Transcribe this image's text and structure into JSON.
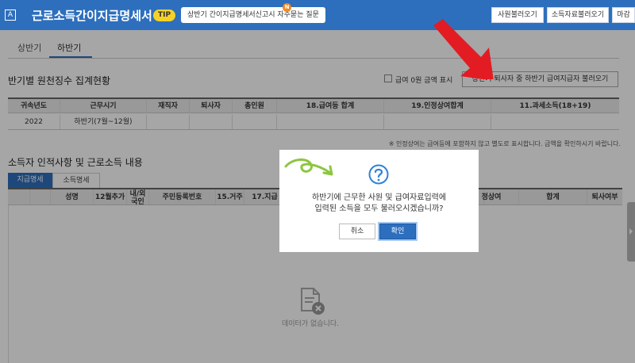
{
  "header": {
    "logo": "A",
    "title": "근로소득간이지급명세서",
    "tip_badge": "TIP",
    "tip_text": "상반기 간이지급명세서신고시 자주묻는 질문",
    "tip_new": "N",
    "buttons": [
      "사원불러오기",
      "소득자료불러오기",
      "마감"
    ]
  },
  "period_tabs": [
    "상반기",
    "하반기"
  ],
  "summary": {
    "title": "반기별 원천징수 집계현황",
    "checkbox_label": "급여 0원 금액 표시",
    "load_button": "상반기 퇴사자 중 하반기 급여지급자 불러오기",
    "columns": [
      "귀속년도",
      "근무시기",
      "재직자",
      "퇴사자",
      "총인원",
      "18.급여등 합계",
      "19.인정상여합계",
      "11.과세소득(18+19)"
    ],
    "row": [
      "2022",
      "하반기(7월~12월)",
      "",
      "",
      "",
      "",
      "",
      ""
    ]
  },
  "note": "※ 인정상여는 급여등에 포함하지 않고 별도로 표시합니다. 금액을 확인하시기 바랍니다.",
  "detail": {
    "title": "소득자 인적사항 및 근로소득 내용",
    "sub_tabs": [
      "지급명세",
      "소득명세"
    ],
    "columns": [
      "성명",
      "12월추가",
      "내/외국인",
      "주민등록번호",
      "15.거주",
      "17.지급",
      "정상여",
      "합계",
      "퇴사여부"
    ],
    "empty_text": "데이터가 없습니다."
  },
  "modal": {
    "line1": "하반기에 근무한 사원 및 급여자료입력에",
    "line2": "입력된 소득을 모두 불러오시겠습니까?",
    "cancel": "취소",
    "ok": "확인"
  },
  "colors": {
    "header": "#2e6fbd",
    "tip_badge": "#f6d226",
    "arrow": "#e31b23",
    "squiggle": "#8cc63f"
  }
}
